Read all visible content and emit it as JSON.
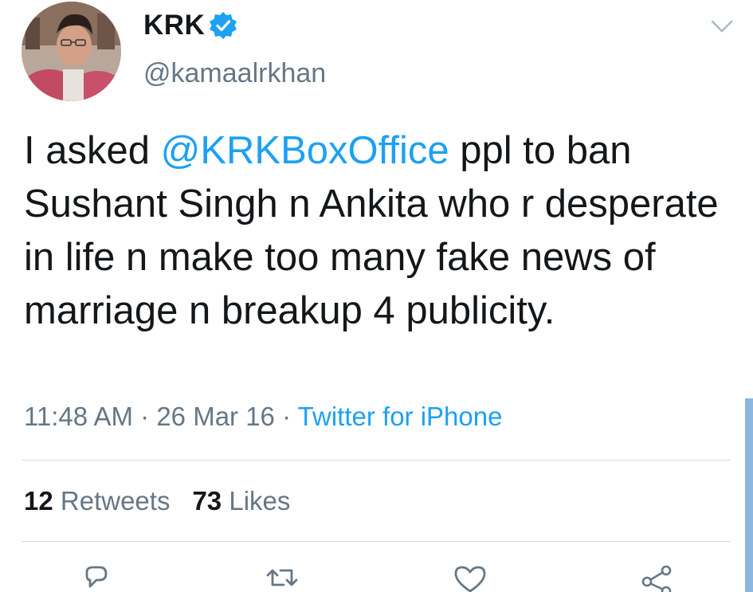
{
  "user": {
    "display_name": "KRK",
    "handle": "@kamaalrkhan"
  },
  "tweet": {
    "text_before": "I asked ",
    "mention": "@KRKBoxOffice",
    "text_after": " ppl to ban Sushant Singh n Ankita who r desperate in life n make too many fake news of marriage n breakup 4 publicity.",
    "time": "11:48 AM",
    "date": "26 Mar 16",
    "separator": "·",
    "source": "Twitter for iPhone"
  },
  "stats": {
    "retweets_count": "12",
    "retweets_label": "Retweets",
    "likes_count": "73",
    "likes_label": "Likes"
  },
  "colors": {
    "link": "#1da1f2",
    "secondary_text": "#657786",
    "primary_text": "#14171a",
    "divider": "#d6dbdf"
  },
  "icons": {
    "verified": "verified-badge-icon",
    "menu": "chevron-down-icon",
    "reply": "reply-icon",
    "retweet": "retweet-icon",
    "like": "heart-icon",
    "share": "share-icon"
  }
}
